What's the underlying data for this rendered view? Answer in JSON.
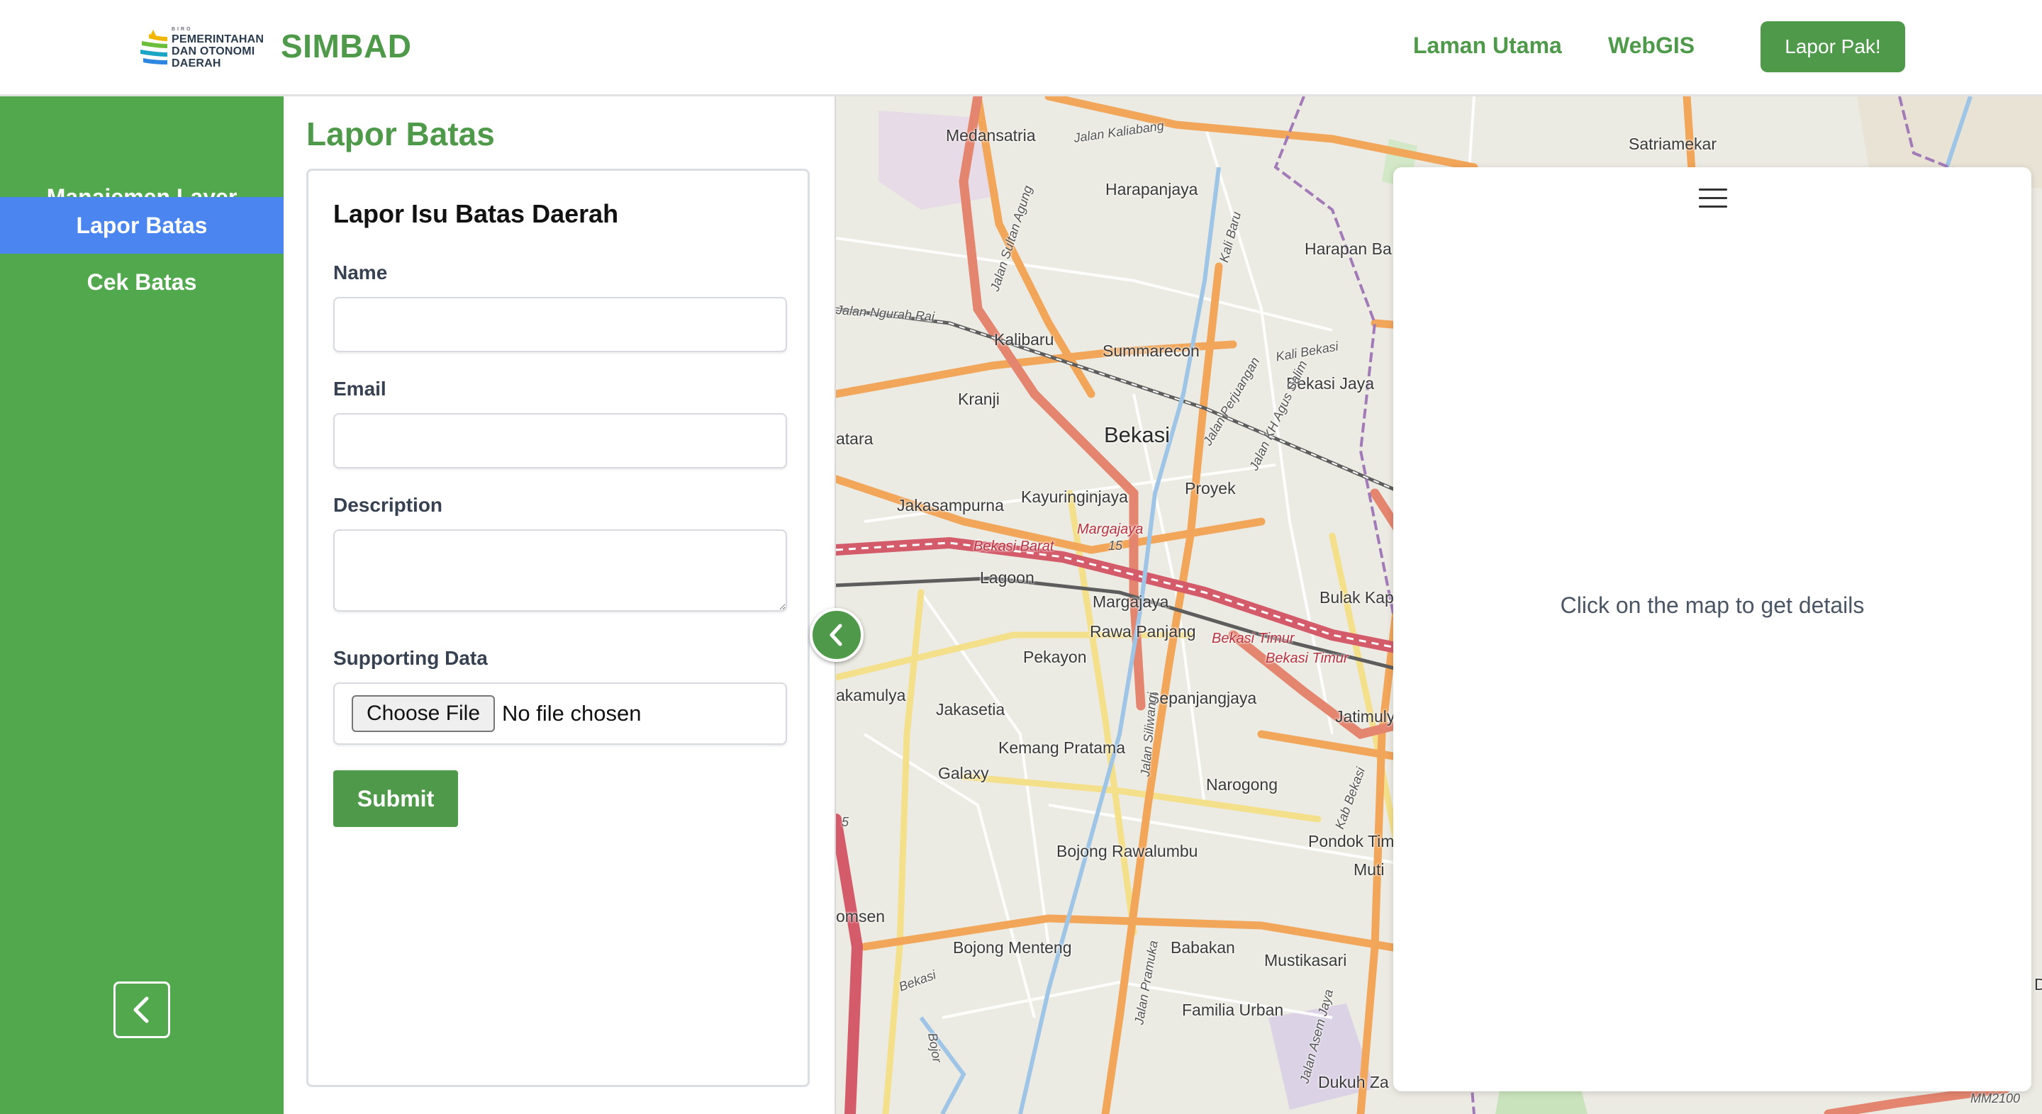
{
  "header": {
    "logo_text": [
      "BIRO",
      "PEMERINTAHAN",
      "DAN OTONOMI",
      "DAERAH"
    ],
    "app_name": "SIMBAD",
    "nav": [
      {
        "label": "Laman Utama"
      },
      {
        "label": "WebGIS"
      }
    ],
    "report_button": "Lapor Pak!"
  },
  "sidebar": {
    "items": [
      {
        "label": "Manajemen Layer",
        "active": false
      },
      {
        "label": "Lapor Batas",
        "active": true
      },
      {
        "label": "Cek Batas",
        "active": false
      }
    ],
    "collapse_icon": "chevron-left-icon"
  },
  "form": {
    "page_title": "Lapor Batas",
    "card_title": "Lapor Isu Batas Daerah",
    "fields": {
      "name": {
        "label": "Name",
        "value": ""
      },
      "email": {
        "label": "Email",
        "value": ""
      },
      "description": {
        "label": "Description",
        "value": ""
      },
      "supporting_data": {
        "label": "Supporting Data",
        "button": "Choose File",
        "status": "No file chosen"
      }
    },
    "submit": "Submit"
  },
  "map": {
    "toggle_icon": "chevron-left-icon",
    "labels": {
      "medansatria": "Medansatria",
      "harapanjaya": "Harapanjaya",
      "kalibaru": "Kalibaru",
      "summarecon": "Summarecon",
      "kranji": "Kranji",
      "bekasi": "Bekasi",
      "jakasampurna": "Jakasampurna",
      "kayuringinjaya": "Kayuringinjaya",
      "proyek": "Proyek",
      "lagoon": "Lagoon",
      "margajaya": "Margajaya",
      "rawa_panjang": "Rawa Panjang",
      "pekayon": "Pekayon",
      "jakasetia": "Jakasetia",
      "sepanjangjaya": "Sepanjangjaya",
      "kemang_pratama": "Kemang Pratama",
      "galaxy": "Galaxy",
      "narogong": "Narogong",
      "bojong_rawalumbu": "Bojong Rawalumbu",
      "bojong_menteng": "Bojong Menteng",
      "babakan": "Babakan",
      "mustikasari": "Mustikasari",
      "familia_urban": "Familia Urban",
      "satriamekar": "Satriamekar",
      "harapan_ba": "Harapan Ba",
      "bekasi_jaya": "Bekasi Jaya",
      "bulak_kap": "Bulak Kap",
      "jatimuly": "Jatimuly",
      "pondok_timu": "Pondok Timu",
      "muti": "Muti",
      "dukuh_za": "Dukuh Za",
      "amulya": "akamulya",
      "omsen": "omsen",
      "atara": "atara",
      "bekasi_barat": "Bekasi Barat",
      "bekasi_timur": "Bekasi Timur",
      "bekasi_timur_2": "Bekasi Timur",
      "margajaya_road": "Margajaya",
      "jalan_kaliabang": "Jalan Kaliabang",
      "jalan_sultan_agung": "Jalan Sultan Agung",
      "jalan_perjuangan": "Jalan Perjuangan",
      "jalan_kh_agus_salim": "Jalan KH Agus Salim",
      "jalan_siliwangi": "Jalan Siliwangi",
      "jalan_pramuka": "Jalan Pramuka",
      "jalan_asem_jaya": "Jalan Asem Jaya",
      "kali_bekasi": "Kali Bekasi",
      "kali_baru": "Kali Baru",
      "kab_bekasi": "Kab Bekasi",
      "bojor": "Bojor",
      "bekasi_small": "Bekasi",
      "ngurah_rai": "Jalan Ngurah Rai",
      "mm2100": "MM2100",
      "num_15": "15",
      "num_5": "5",
      "d": "D"
    }
  },
  "detail_panel": {
    "menu_icon": "hamburger-menu-icon",
    "message": "Click on the map to get details"
  },
  "colors": {
    "brand_green": "#4e9a4a",
    "sidebar_green": "#52a84c",
    "active_blue": "#4a85f0"
  }
}
